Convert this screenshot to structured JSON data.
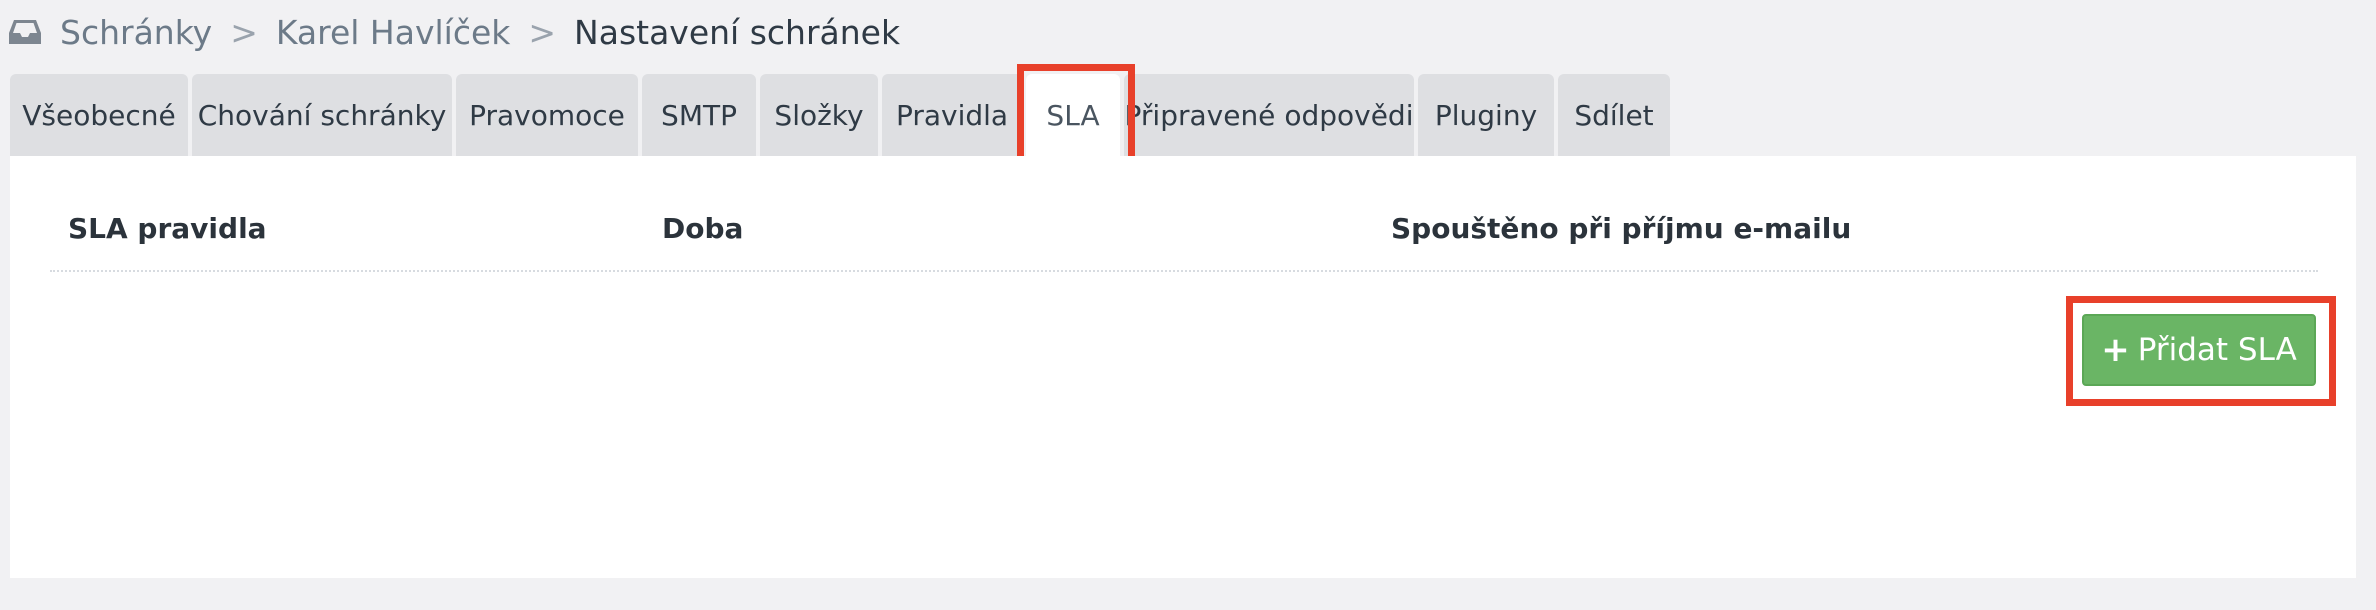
{
  "breadcrumb": {
    "items": [
      "Schránky",
      "Karel Havlíček",
      "Nastavení schránek"
    ],
    "separator": ">"
  },
  "tabs": [
    {
      "label": "Všeobecné"
    },
    {
      "label": "Chování schránky"
    },
    {
      "label": "Pravomoce"
    },
    {
      "label": "SMTP"
    },
    {
      "label": "Složky"
    },
    {
      "label": "Pravidla"
    },
    {
      "label": "SLA",
      "active": true
    },
    {
      "label": "Připravené odpovědi"
    },
    {
      "label": "Pluginy"
    },
    {
      "label": "Sdílet"
    }
  ],
  "table": {
    "columns": [
      "SLA pravidla",
      "Doba",
      "Spouštěno při příjmu e-mailu"
    ],
    "rows": []
  },
  "actions": {
    "add_sla_label": "Přidat SLA",
    "add_icon": "plus-icon",
    "add_color": "#6ab565"
  },
  "highlight_color": "#e8402a"
}
